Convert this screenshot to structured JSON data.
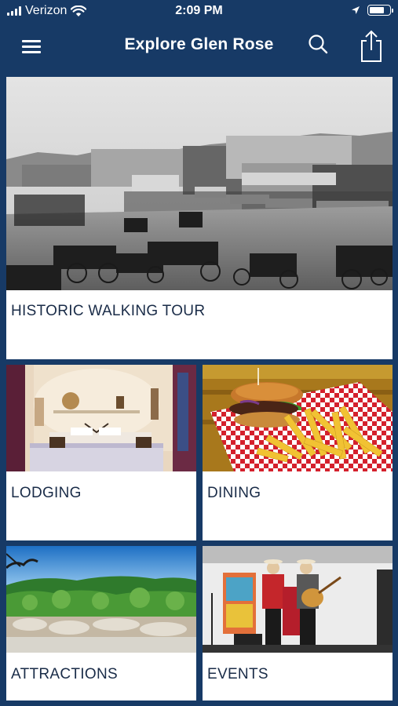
{
  "status_bar": {
    "carrier": "Verizon",
    "time": "2:09 PM",
    "battery_level": 0.75
  },
  "nav": {
    "title": "Explore Glen Rose",
    "menu_icon": "hamburger-menu-icon",
    "search_icon": "search-icon",
    "share_icon": "share-icon"
  },
  "colors": {
    "background": "#173a66",
    "card": "#ffffff",
    "label_text": "#1a2c48"
  },
  "cards": {
    "walking_tour": {
      "label": "HISTORIC WALKING TOUR",
      "image": "historic-street-photo"
    },
    "lodging": {
      "label": "LODGING",
      "image": "bedroom-photo"
    },
    "dining": {
      "label": "DINING",
      "image": "burger-and-fries-photo"
    },
    "attractions": {
      "label": "ATTRACTIONS",
      "image": "landscape-river-photo"
    },
    "events": {
      "label": "EVENTS",
      "image": "musicians-on-stage-photo"
    }
  }
}
